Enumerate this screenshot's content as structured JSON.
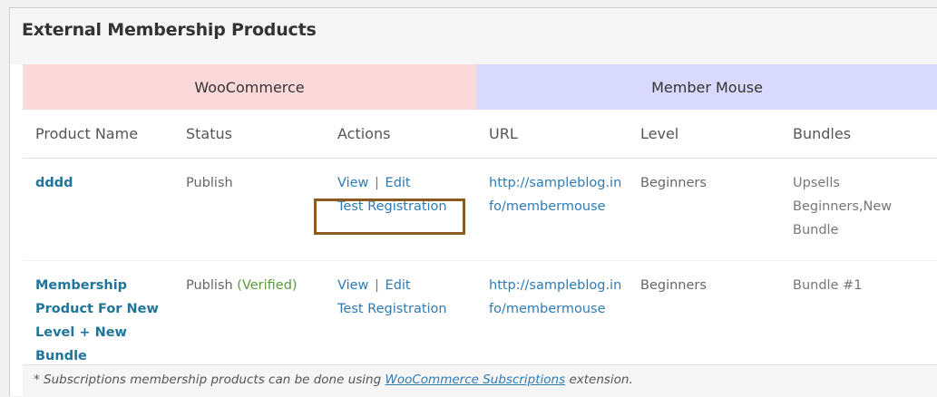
{
  "panel": {
    "title": "External Membership Products"
  },
  "groups": {
    "woocommerce": "WooCommerce",
    "member_mouse": "Member Mouse"
  },
  "columns": [
    "Product Name",
    "Status",
    "Actions",
    "URL",
    "Level",
    "Bundles"
  ],
  "rows": [
    {
      "product_name": "dddd",
      "status": "Publish",
      "status_note": "",
      "action_view": "View",
      "action_sep": "|",
      "action_edit": "Edit",
      "action_test": "Test Registration",
      "url": "http://sampleblog.info/membermouse",
      "level": "Beginners",
      "bundles": "Upsells Beginners,New Bundle"
    },
    {
      "product_name": "Membership Product For New Level + New Bundle",
      "status": "Publish",
      "status_note": "(Verified)",
      "action_view": "View",
      "action_sep": "|",
      "action_edit": "Edit",
      "action_test": "Test Registration",
      "url": "http://sampleblog.info/membermouse",
      "level": "Beginners",
      "bundles": "Bundle #1"
    }
  ],
  "footer": {
    "prefix": "* Subscriptions membership products can be done using",
    "link": "WooCommerce Subscriptions",
    "suffix": "extension."
  },
  "colors": {
    "woocommerce_band": "#fbd9d9",
    "member_mouse_band": "#d9d9fb",
    "link": "#2e7bb4",
    "verified": "#5a9a3a",
    "highlight": "#8c5a1e"
  }
}
